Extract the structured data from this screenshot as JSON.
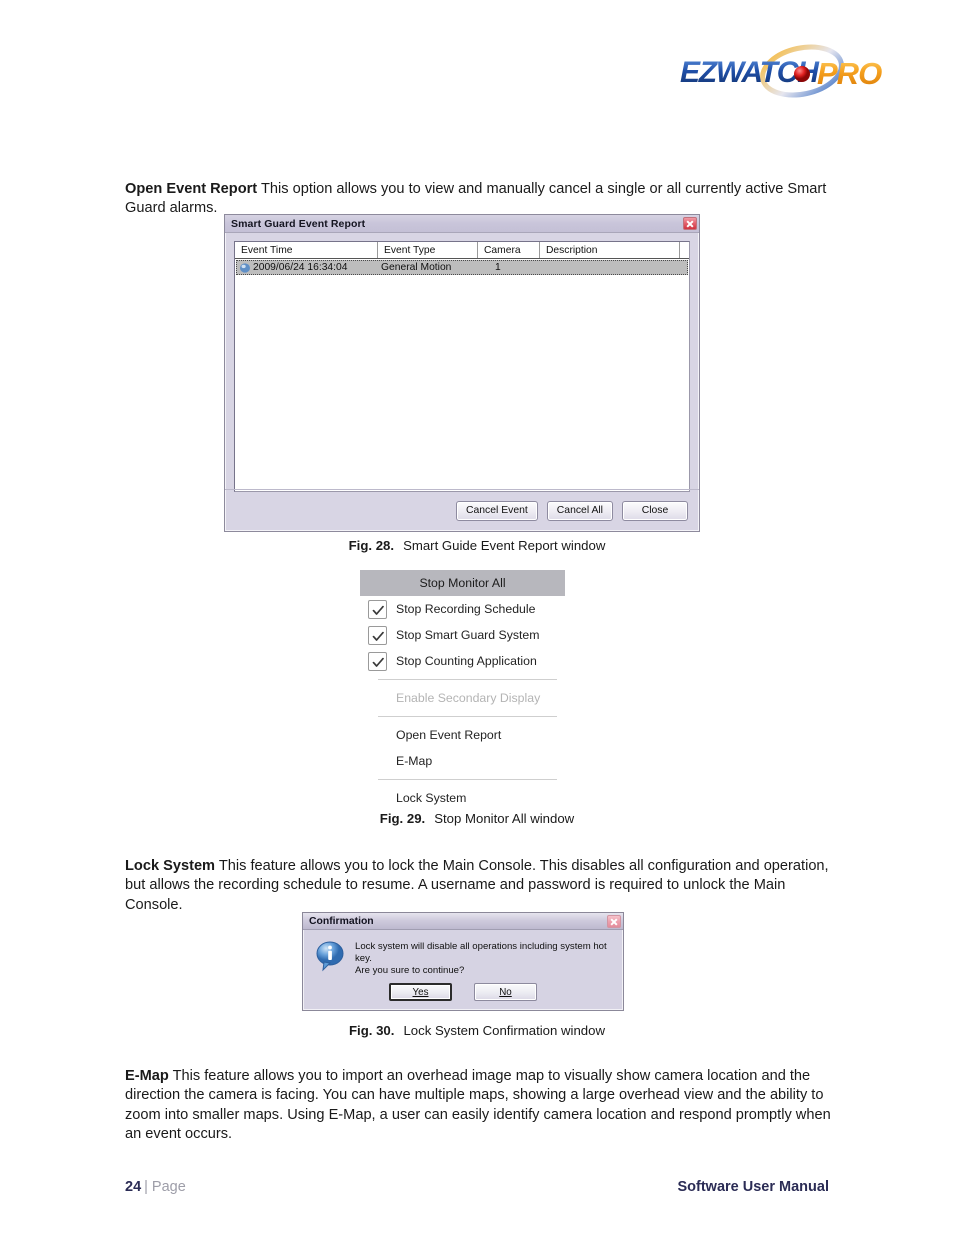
{
  "header": {
    "logo_text_primary": "EZWATCH",
    "logo_text_secondary": "PRO"
  },
  "paragraphs": {
    "open_event_report": {
      "term": "Open Event Report",
      "text": " This option allows you to view and manually cancel a single or all currently active Smart Guard alarms."
    },
    "lock_system": {
      "term": "Lock System",
      "text": " This feature allows you to lock the Main Console. This disables all configuration and operation, but allows the recording schedule to resume. A username and password is required to unlock the Main Console."
    },
    "e_map": {
      "term": "E-Map",
      "text": " This feature allows you to import an overhead image map to visually show camera location and the direction the camera is facing. You can have multiple maps, showing a large overhead view and the ability to zoom into smaller maps. Using E-Map, a user can easily identify camera location and respond promptly when an event occurs."
    }
  },
  "captions": {
    "fig28": {
      "number": "Fig. 28.",
      "text": "Smart Guide Event Report window"
    },
    "fig29": {
      "number": "Fig. 29.",
      "text": "Stop Monitor All window"
    },
    "fig30": {
      "number": "Fig. 30.",
      "text": "Lock System Confirmation window"
    }
  },
  "event_report_window": {
    "title": "Smart Guard Event Report",
    "close_label": "×",
    "columns": [
      "Event Time",
      "Event Type",
      "Camera",
      "Description",
      ""
    ],
    "rows": [
      {
        "event_time": "2009/06/24 16:34:04",
        "event_type": "General Motion",
        "camera": "1",
        "description": ""
      }
    ],
    "buttons": {
      "cancel_event": "Cancel Event",
      "cancel_all": "Cancel All",
      "close": "Close"
    }
  },
  "stop_monitor_menu": {
    "items": [
      {
        "label": "Stop Monitor All",
        "type": "header",
        "checked": false
      },
      {
        "label": "Stop Recording Schedule",
        "type": "checkbox",
        "checked": true
      },
      {
        "label": "Stop Smart Guard System",
        "type": "checkbox",
        "checked": true
      },
      {
        "label": "Stop Counting Application",
        "type": "checkbox",
        "checked": true
      },
      {
        "label": "Enable Secondary Display",
        "type": "disabled",
        "checked": false
      },
      {
        "label": "Open Event Report",
        "type": "plain",
        "checked": false
      },
      {
        "label": "E-Map",
        "type": "plain",
        "checked": false
      },
      {
        "label": "Lock System",
        "type": "plain",
        "checked": false
      }
    ]
  },
  "confirmation_dialog": {
    "title": "Confirmation",
    "message_line1": "Lock system will disable all operations including system hot key.",
    "message_line2": "Are you sure to continue?",
    "yes_label": "Yes",
    "yes_mnemonic": "Y",
    "no_label": "No",
    "no_mnemonic": "N",
    "icon": "info-icon"
  },
  "footer": {
    "page_number": "24",
    "page_label": "| Page",
    "manual_title": "Software User Manual"
  },
  "colors": {
    "brand_blue": "#1f4fa8",
    "brand_orange": "#f5a01e",
    "navy": "#2b2c55",
    "gray": "#9d9da8",
    "close_red": "#d0333f"
  }
}
